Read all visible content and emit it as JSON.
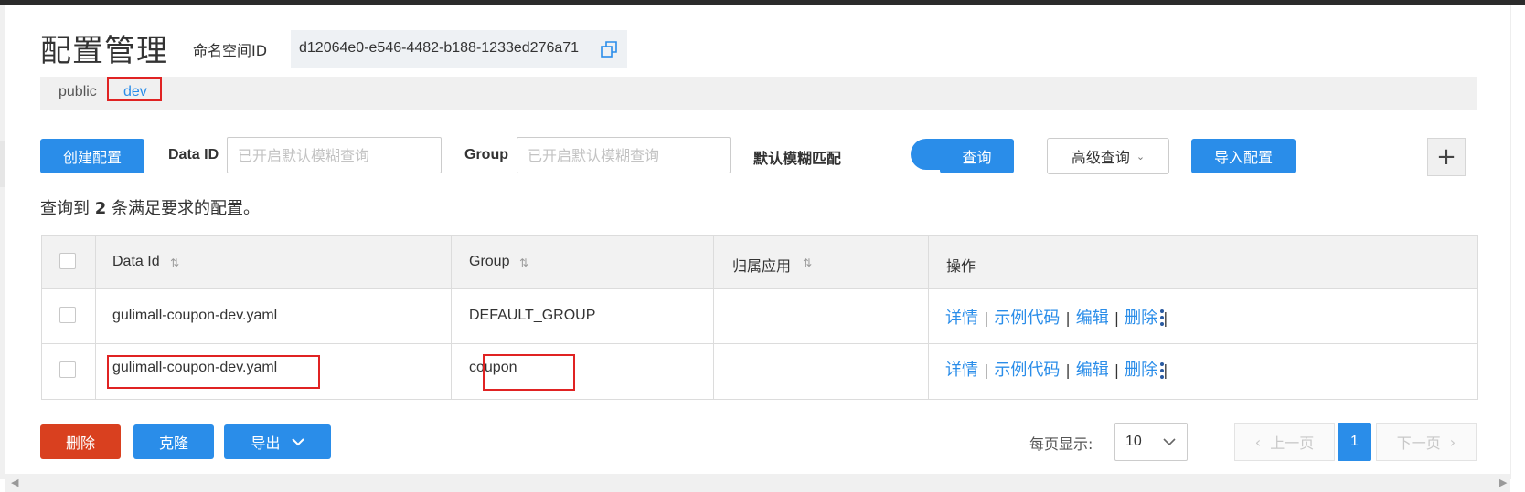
{
  "header": {
    "title": "配置管理",
    "namespace_label": "命名空间ID",
    "namespace_id": "d12064e0-e546-4482-b188-1233ed276a71"
  },
  "namespace_tabs": [
    {
      "label": "public"
    },
    {
      "label": "dev"
    }
  ],
  "toolbar": {
    "create_label": "创建配置",
    "data_id_label": "Data ID",
    "data_id_placeholder": "已开启默认模糊查询",
    "group_label": "Group",
    "group_placeholder": "已开启默认模糊查询",
    "fuzzy_label": "默认模糊匹配",
    "fuzzy_on": true,
    "query_label": "查询",
    "advanced_label": "高级查询",
    "import_label": "导入配置",
    "plus_label": "+"
  },
  "summary": {
    "prefix": "查询到",
    "count": "2",
    "suffix": "条满足要求的配置。"
  },
  "table": {
    "columns": [
      "Data Id",
      "Group",
      "归属应用",
      "操作"
    ],
    "rows": [
      {
        "data_id": "gulimall-coupon-dev.yaml",
        "group": "DEFAULT_GROUP",
        "app": ""
      },
      {
        "data_id": "gulimall-coupon-dev.yaml",
        "group": "coupon",
        "app": ""
      }
    ],
    "ops": {
      "detail": "详情",
      "sample": "示例代码",
      "edit": "编辑",
      "delete": "删除",
      "sep": "|"
    }
  },
  "footer": {
    "delete_label": "删除",
    "clone_label": "克隆",
    "export_label": "导出",
    "page_size_label": "每页显示:",
    "page_size": "10",
    "prev_label": "上一页",
    "current_page": "1",
    "next_label": "下一页"
  },
  "colors": {
    "primary": "#2a8de9",
    "danger": "#d9401f",
    "highlight_box": "#e02323"
  }
}
